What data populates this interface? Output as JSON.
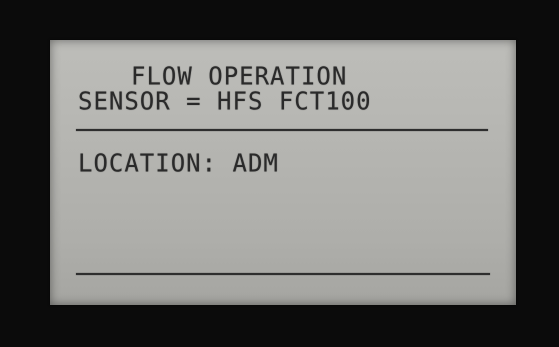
{
  "display": {
    "title": "FLOW OPERATION",
    "sensor_line": "SENSOR = HFS FCT100",
    "location_line": "LOCATION: ADM"
  },
  "colors": {
    "lcd_background": "#b8b8b4",
    "lcd_text": "#2a2a2a",
    "bezel": "#0b0b0b"
  }
}
